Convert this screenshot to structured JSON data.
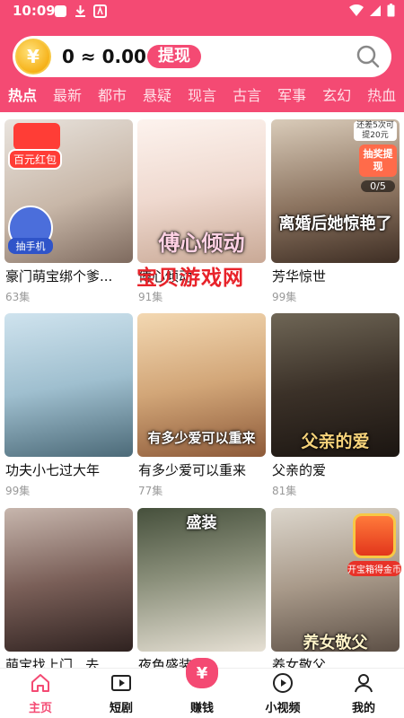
{
  "status": {
    "time": "10:09"
  },
  "header": {
    "coin_symbol": "¥",
    "balance": "0 ≈ 0.00",
    "withdraw_label": "提现"
  },
  "tabs": [
    "热点",
    "最新",
    "都市",
    "悬疑",
    "现言",
    "古言",
    "军事",
    "玄幻",
    "热血"
  ],
  "badges": {
    "red_packet": "百元红包",
    "phone": "抽手机",
    "lottery_note": "还差5次可提20元",
    "lottery_box": "抽奖提现",
    "lottery_count": "0/5",
    "treasure": "开宝箱得金币"
  },
  "watermark": "宝贝游戏网",
  "dramas": [
    {
      "title": "豪门萌宝绑个爹...",
      "episodes": "63集",
      "poster_text": ""
    },
    {
      "title": "傅心倾动",
      "episodes": "91集",
      "poster_text": "傅心倾动"
    },
    {
      "title": "芳华惊世",
      "episodes": "99集",
      "poster_text": "离婚后她惊艳了"
    },
    {
      "title": "功夫小七过大年",
      "episodes": "99集",
      "poster_text": ""
    },
    {
      "title": "有多少爱可以重来",
      "episodes": "77集",
      "poster_text": "有多少爱可以重来"
    },
    {
      "title": "父亲的爱",
      "episodes": "81集",
      "poster_text": "父亲的爱"
    },
    {
      "title": "萌宝找上门...去",
      "episodes": "",
      "poster_text": ""
    },
    {
      "title": "夜色盛装",
      "episodes": "",
      "poster_text": "盛装"
    },
    {
      "title": "养女敬父",
      "episodes": "",
      "poster_text": "养女敬父"
    }
  ],
  "nav": [
    {
      "label": "主页",
      "icon": "home-icon",
      "active": true
    },
    {
      "label": "短剧",
      "icon": "play-icon",
      "active": false
    },
    {
      "label": "赚钱",
      "icon": "money-bag-icon",
      "active": false
    },
    {
      "label": "小视频",
      "icon": "video-icon",
      "active": false
    },
    {
      "label": "我的",
      "icon": "user-icon",
      "active": false
    }
  ],
  "colors": {
    "accent": "#f44a73",
    "coin": "#f6b21a"
  }
}
